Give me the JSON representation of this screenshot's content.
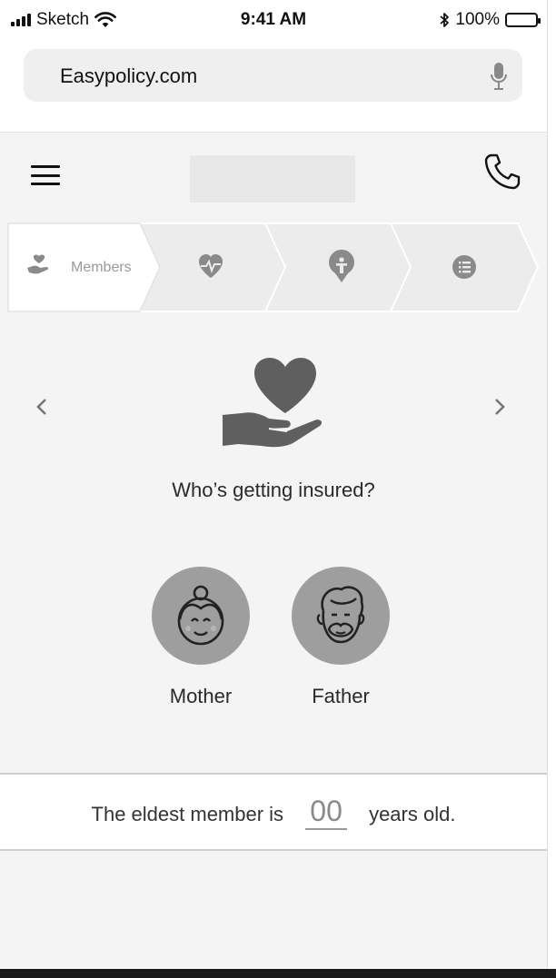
{
  "status_bar": {
    "carrier": "Sketch",
    "time": "9:41 AM",
    "battery": "100%"
  },
  "browser": {
    "url": "Easypolicy.com"
  },
  "stepper": {
    "steps": [
      {
        "label": "Members",
        "icon": "hand-heart-icon",
        "active": true
      },
      {
        "label": "",
        "icon": "heartbeat-icon",
        "active": false
      },
      {
        "label": "",
        "icon": "person-pin-icon",
        "active": false
      },
      {
        "label": "",
        "icon": "list-icon",
        "active": false
      }
    ]
  },
  "main": {
    "question": "Who’s getting insured?",
    "members": [
      {
        "label": "Mother",
        "icon": "mother-avatar-icon"
      },
      {
        "label": "Father",
        "icon": "father-avatar-icon"
      }
    ]
  },
  "age_bar": {
    "prefix": "The eldest member is",
    "value": "00",
    "suffix": "years old."
  },
  "colors": {
    "background": "#f4f4f4",
    "icon_gray": "#666666",
    "avatar_circle": "#9e9e9e"
  }
}
